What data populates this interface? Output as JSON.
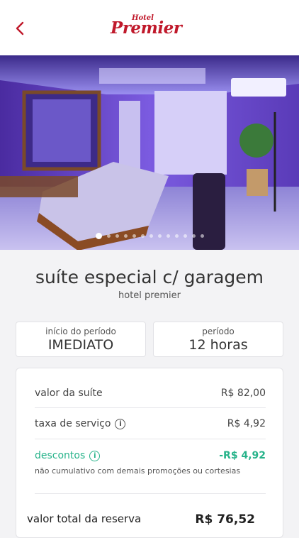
{
  "header": {
    "logo_small": "Hotel",
    "logo_big": "Premier",
    "brand_color": "#c0192b"
  },
  "gallery": {
    "dot_count": 13,
    "active_index": 0
  },
  "suite": {
    "name": "suíte especial c/ garagem",
    "hotel": "hotel premier"
  },
  "period": {
    "start_label": "início do período",
    "start_value": "IMEDIATO",
    "duration_label": "período",
    "duration_value": "12 horas"
  },
  "pricing": {
    "suite_value_label": "valor da suíte",
    "suite_value": "R$ 82,00",
    "service_fee_label": "taxa de serviço",
    "service_fee": "R$ 4,92",
    "discount_label": "descontos",
    "discount": "-R$ 4,92",
    "discount_note": "não cumulativo com demais promoções ou cortesias",
    "discount_color": "#27b38a",
    "total_label": "valor total da reserva",
    "total": "R$ 76,52"
  }
}
